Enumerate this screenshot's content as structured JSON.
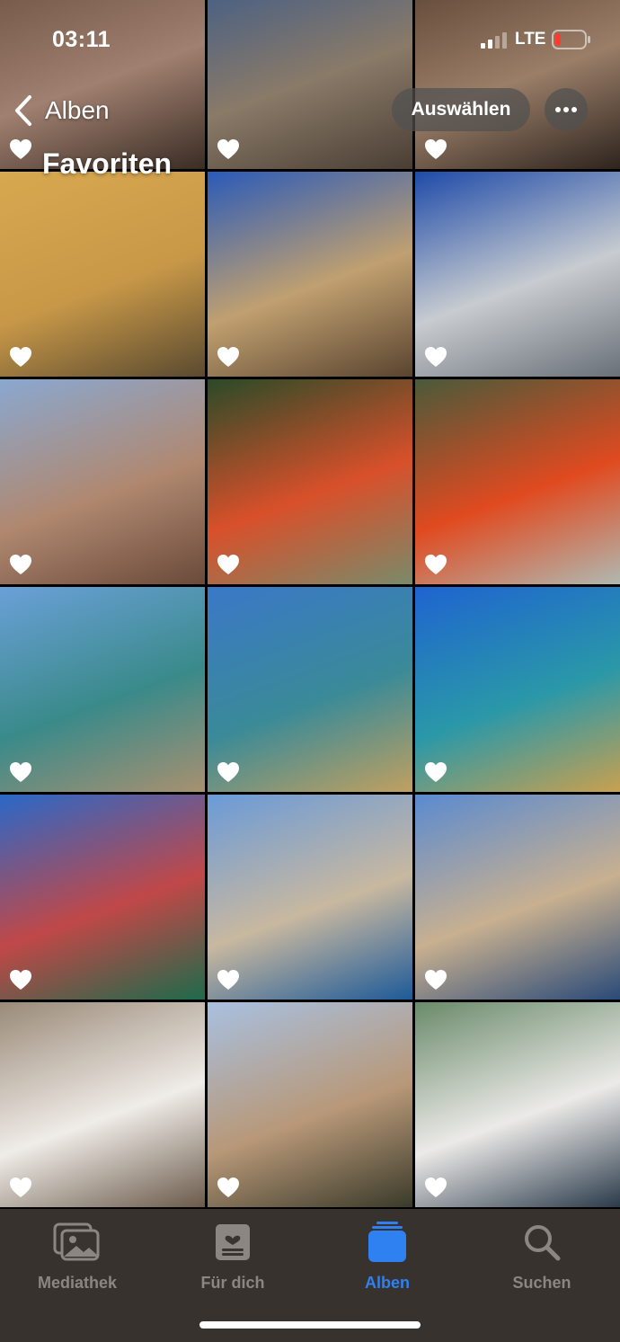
{
  "status_bar": {
    "time": "03:11",
    "network": "LTE",
    "signal_icon": "cellular-signal-icon",
    "battery_icon": "battery-low-icon",
    "battery_color": "#ff3b30"
  },
  "header": {
    "back_label": "Alben",
    "title": "Favoriten",
    "select_label": "Auswählen",
    "more_icon": "ellipsis-icon"
  },
  "photos": [
    {
      "subject": "Venetian brick buildings",
      "favorite": true,
      "colors": [
        "#6b5040",
        "#a08070",
        "#3a2c24"
      ]
    },
    {
      "subject": "Statue and palazzo",
      "favorite": true,
      "colors": [
        "#3a5a8a",
        "#8a7a68",
        "#4a3e34"
      ]
    },
    {
      "subject": "Palazzo with flower balconies",
      "favorite": true,
      "colors": [
        "#5a4030",
        "#9a7e68",
        "#2e241e"
      ]
    },
    {
      "subject": "Yellow hotel on canal",
      "favorite": true,
      "colors": [
        "#d8a850",
        "#c89848",
        "#5a4a30"
      ]
    },
    {
      "subject": "Basilica arches",
      "favorite": true,
      "colors": [
        "#2a5ab8",
        "#c0a070",
        "#5a4430"
      ]
    },
    {
      "subject": "White marble facade",
      "favorite": true,
      "colors": [
        "#1e4aa8",
        "#c8ccd0",
        "#6a7078"
      ]
    },
    {
      "subject": "Brick palazzo windows",
      "favorite": true,
      "colors": [
        "#8aa8d0",
        "#b08870",
        "#6a4a3a"
      ]
    },
    {
      "subject": "Red berries plant",
      "favorite": true,
      "colors": [
        "#2a4a28",
        "#d8502a",
        "#7a8a6a"
      ]
    },
    {
      "subject": "Berries plant near gate",
      "favorite": true,
      "colors": [
        "#4a5a3a",
        "#e04a20",
        "#b0b8b0"
      ]
    },
    {
      "subject": "Grand Canal view",
      "favorite": true,
      "colors": [
        "#6aa0d8",
        "#3a8a8a",
        "#a89070"
      ]
    },
    {
      "subject": "Grand Canal with Salute",
      "favorite": true,
      "colors": [
        "#3a78c8",
        "#3a8a98",
        "#c0a060"
      ]
    },
    {
      "subject": "Grand Canal blue sky",
      "favorite": true,
      "colors": [
        "#1e64d0",
        "#2a98a8",
        "#c8a050"
      ]
    },
    {
      "subject": "Balcony with red flowers",
      "favorite": true,
      "colors": [
        "#2a68c8",
        "#c04848",
        "#1e6a4a"
      ]
    },
    {
      "subject": "Gondolas at station",
      "favorite": true,
      "colors": [
        "#6a9ad8",
        "#c8b8a0",
        "#1e5a98"
      ]
    },
    {
      "subject": "Gondolas and palazzi",
      "favorite": true,
      "colors": [
        "#5a8ad0",
        "#c8b090",
        "#2a4a78"
      ]
    },
    {
      "subject": "Open book in square",
      "favorite": true,
      "colors": [
        "#9a8a78",
        "#f0ece8",
        "#6a5a4a"
      ]
    },
    {
      "subject": "Narrow canal",
      "favorite": true,
      "colors": [
        "#a8c0e0",
        "#b89878",
        "#3a3a2a"
      ]
    },
    {
      "subject": "Open book close-up",
      "favorite": true,
      "colors": [
        "#6a8a6a",
        "#eceae8",
        "#2a3a4a"
      ]
    }
  ],
  "tab_bar": {
    "active_color": "#2f80f0",
    "inactive_color": "#8b8682",
    "tabs": [
      {
        "label": "Mediathek",
        "icon": "photo-library-icon",
        "active": false
      },
      {
        "label": "Für dich",
        "icon": "for-you-icon",
        "active": false
      },
      {
        "label": "Alben",
        "icon": "albums-icon",
        "active": true
      },
      {
        "label": "Suchen",
        "icon": "search-icon",
        "active": false
      }
    ]
  }
}
